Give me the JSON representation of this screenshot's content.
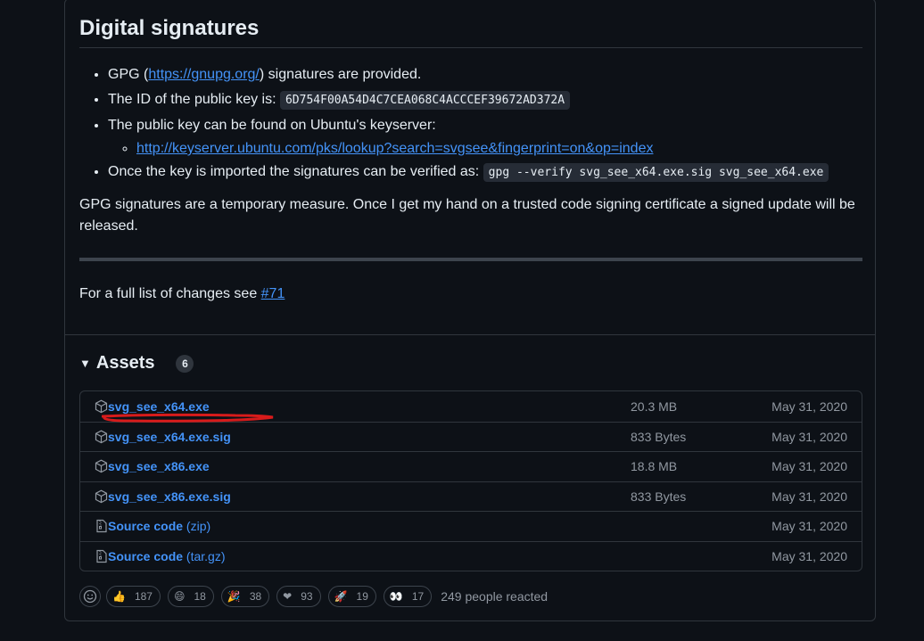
{
  "signatures": {
    "heading": "Digital signatures",
    "bullet1_pre": "GPG (",
    "bullet1_link": "https://gnupg.org/",
    "bullet1_post": ") signatures are provided.",
    "bullet2_pre": "The ID of the public key is: ",
    "key_id": "6D754F00A54D4C7CEA068C4ACCCEF39672AD372A",
    "bullet3": "The public key can be found on Ubuntu's keyserver:",
    "keyserver_link": "http://keyserver.ubuntu.com/pks/lookup?search=svgsee&fingerprint=on&op=index",
    "bullet4_pre": "Once the key is imported the signatures can be verified as: ",
    "verify_cmd": "gpg --verify svg_see_x64.exe.sig svg_see_x64.exe",
    "note": "GPG signatures are a temporary measure. Once I get my hand on a trusted code signing certificate a signed update will be released."
  },
  "changes": {
    "text": "For a full list of changes see ",
    "link": "#71"
  },
  "assets": {
    "title": "Assets",
    "count": "6",
    "rows": [
      {
        "name": "svg_see_x64.exe",
        "ext": "",
        "size": "20.3 MB",
        "date": "May 31, 2020",
        "icon": "package-icon"
      },
      {
        "name": "svg_see_x64.exe.sig",
        "ext": "",
        "size": "833 Bytes",
        "date": "May 31, 2020",
        "icon": "package-icon"
      },
      {
        "name": "svg_see_x86.exe",
        "ext": "",
        "size": "18.8 MB",
        "date": "May 31, 2020",
        "icon": "package-icon"
      },
      {
        "name": "svg_see_x86.exe.sig",
        "ext": "",
        "size": "833 Bytes",
        "date": "May 31, 2020",
        "icon": "package-icon"
      },
      {
        "name": "Source code",
        "ext": " (zip)",
        "size": "",
        "date": "May 31, 2020",
        "icon": "file-zip-icon"
      },
      {
        "name": "Source code",
        "ext": " (tar.gz)",
        "size": "",
        "date": "May 31, 2020",
        "icon": "file-zip-icon"
      }
    ]
  },
  "reactions": {
    "items": [
      {
        "emoji": "👍",
        "count": "187"
      },
      {
        "emoji": "😄",
        "count": "18"
      },
      {
        "emoji": "🎉",
        "count": "38"
      },
      {
        "emoji": "❤",
        "count": "93"
      },
      {
        "emoji": "🚀",
        "count": "19"
      },
      {
        "emoji": "👀",
        "count": "17"
      }
    ],
    "summary": "249 people reacted"
  },
  "colors": {
    "link": "#4493f8",
    "background": "#0d1117",
    "annotation": "#d81b1b"
  }
}
